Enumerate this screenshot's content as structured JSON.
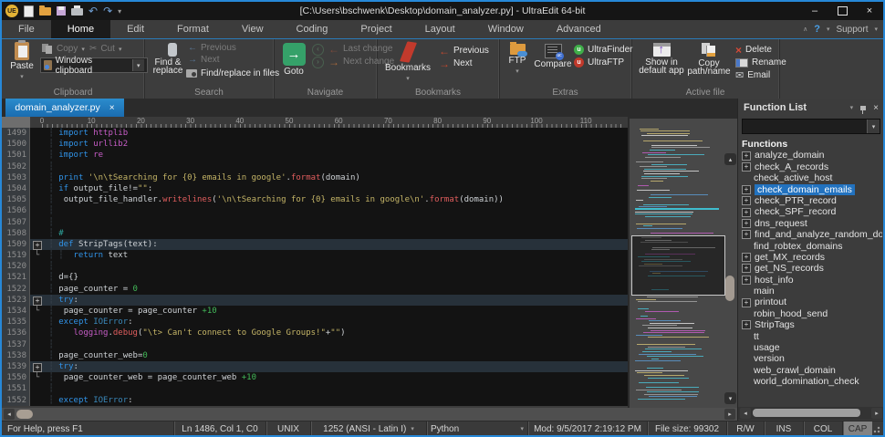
{
  "window": {
    "logo": "UE",
    "title": "[C:\\Users\\bschwenk\\Desktop\\domain_analyzer.py] - UltraEdit 64-bit",
    "minimize": "–",
    "close": "×"
  },
  "icons": {
    "dropdown": "▾",
    "collapse": "∧",
    "help": "?",
    "undo": "↶",
    "redo": "↷",
    "scissors": "✂",
    "envelope": "✉",
    "left": "◂",
    "right": "▸",
    "up": "▴",
    "down": "▾",
    "arrow_left": "←",
    "arrow_right": "→",
    "goto_arrow": "→",
    "delete_x": "×",
    "expand": "+",
    "fold_end": "└",
    "close": "×",
    "circ_left": "‹",
    "circ_right": "›"
  },
  "menu": {
    "items": [
      "File",
      "Home",
      "Edit",
      "Format",
      "View",
      "Coding",
      "Project",
      "Layout",
      "Window",
      "Advanced"
    ],
    "active": "Home",
    "support": "Support"
  },
  "ribbon": {
    "clipboard": {
      "label": "Clipboard",
      "paste": "Paste",
      "copy": "Copy",
      "cut": "Cut",
      "windows_clipboard": "Windows clipboard"
    },
    "search": {
      "label": "Search",
      "find_replace_1": "Find &",
      "find_replace_2": "replace",
      "previous": "Previous",
      "next": "Next",
      "find_in_files": "Find/replace in files"
    },
    "navigate": {
      "label": "Navigate",
      "goto": "Goto",
      "last_change": "Last change",
      "next_change": "Next change"
    },
    "bookmarks": {
      "label": "Bookmarks",
      "bookmarks": "Bookmarks",
      "previous": "Previous",
      "next": "Next"
    },
    "extras": {
      "label": "Extras",
      "ftp": "FTP",
      "compare": "Compare",
      "ultrafinder": "UltraFinder",
      "ultraftp": "UltraFTP",
      "uf_badge": "u",
      "uftp_badge": "u"
    },
    "active_file": {
      "label": "Active file",
      "show_in_1": "Show in",
      "show_in_2": "default app",
      "copy_path_1": "Copy",
      "copy_path_2": "path/name",
      "delete": "Delete",
      "rename": "Rename",
      "email": "Email"
    }
  },
  "editor": {
    "tab": {
      "name": "domain_analyzer.py",
      "close": "×"
    },
    "ruler_marks": [
      "0",
      "10",
      "20",
      "30",
      "40",
      "50",
      "60",
      "70",
      "80",
      "90",
      "100",
      "110"
    ],
    "lines": [
      {
        "n": "1499",
        "t": [
          [
            "gd",
            " ┆ "
          ],
          [
            "kw",
            "import "
          ],
          [
            "mod",
            "httplib"
          ]
        ]
      },
      {
        "n": "1500",
        "t": [
          [
            "gd",
            " ┆ "
          ],
          [
            "kw",
            "import "
          ],
          [
            "mod",
            "urllib2"
          ]
        ]
      },
      {
        "n": "1501",
        "t": [
          [
            "gd",
            " ┆ "
          ],
          [
            "kw",
            "import "
          ],
          [
            "mod",
            "re"
          ]
        ]
      },
      {
        "n": "1502",
        "t": [
          [
            "gd",
            " ┆"
          ]
        ]
      },
      {
        "n": "1503",
        "t": [
          [
            "gd",
            " ┆ "
          ],
          [
            "kw",
            "print "
          ],
          [
            "str",
            "'\\n\\tSearching for {0} emails in google'"
          ],
          [
            "pl",
            "."
          ],
          [
            "fn",
            "format"
          ],
          [
            "pl",
            "(domain)"
          ]
        ]
      },
      {
        "n": "1504",
        "t": [
          [
            "gd",
            " ┆ "
          ],
          [
            "kw",
            "if "
          ],
          [
            "pl",
            "output_file!="
          ],
          [
            "str",
            "\"\""
          ],
          [
            "pl",
            ":"
          ]
        ]
      },
      {
        "n": "1505",
        "t": [
          [
            "gd",
            " ┆  "
          ],
          [
            "pl",
            "output_file_handler."
          ],
          [
            "fn",
            "writelines"
          ],
          [
            "pl",
            "("
          ],
          [
            "str",
            "'\\n\\tSearching for {0} emails in google\\n'"
          ],
          [
            "pl",
            "."
          ],
          [
            "fn",
            "format"
          ],
          [
            "pl",
            "(domain))"
          ]
        ]
      },
      {
        "n": "1506",
        "t": [
          [
            "gd",
            " ┆"
          ]
        ]
      },
      {
        "n": "1507",
        "t": [
          [
            "gd",
            " ┆"
          ]
        ]
      },
      {
        "n": "1508",
        "t": [
          [
            "gd",
            " ┆ "
          ],
          [
            "cmt",
            "#"
          ]
        ]
      },
      {
        "n": "1509",
        "fold": "+",
        "hl": true,
        "t": [
          [
            "gd",
            " ┆ "
          ],
          [
            "kw",
            "def "
          ],
          [
            "pl",
            "StripTags(text):"
          ]
        ]
      },
      {
        "n": "1519",
        "fold": "L",
        "t": [
          [
            "gd",
            " ┆ ┆  "
          ],
          [
            "kw",
            "return "
          ],
          [
            "pl",
            "text"
          ]
        ]
      },
      {
        "n": "1520",
        "t": [
          [
            "gd",
            " ┆"
          ]
        ]
      },
      {
        "n": "1521",
        "t": [
          [
            "gd",
            " ┆ "
          ],
          [
            "pl",
            "d={}"
          ]
        ]
      },
      {
        "n": "1522",
        "t": [
          [
            "gd",
            " ┆ "
          ],
          [
            "pl",
            "page_counter = "
          ],
          [
            "num",
            "0"
          ]
        ]
      },
      {
        "n": "1523",
        "fold": "+",
        "hl": true,
        "t": [
          [
            "gd",
            " ┆ "
          ],
          [
            "kw",
            "try"
          ],
          [
            "pl",
            ":"
          ]
        ]
      },
      {
        "n": "1534",
        "fold": "L",
        "t": [
          [
            "gd",
            " ┆  "
          ],
          [
            "pl",
            "page_counter = page_counter "
          ],
          [
            "num",
            "+10"
          ]
        ]
      },
      {
        "n": "1535",
        "t": [
          [
            "gd",
            " ┆ "
          ],
          [
            "kw",
            "except "
          ],
          [
            "exc",
            "IOError"
          ],
          [
            "pl",
            ":"
          ]
        ]
      },
      {
        "n": "1536",
        "t": [
          [
            "gd",
            " ┆    "
          ],
          [
            "mod",
            "logging"
          ],
          [
            "pl",
            "."
          ],
          [
            "fn",
            "debug"
          ],
          [
            "pl",
            "("
          ],
          [
            "str",
            "\"\\t> Can't connect to Google Groups!\""
          ],
          [
            "pl",
            "+"
          ],
          [
            "str",
            "\"\""
          ],
          [
            "pl",
            ")"
          ]
        ]
      },
      {
        "n": "1537",
        "t": [
          [
            "gd",
            " ┆"
          ]
        ]
      },
      {
        "n": "1538",
        "t": [
          [
            "gd",
            " ┆ "
          ],
          [
            "pl",
            "page_counter_web="
          ],
          [
            "num",
            "0"
          ]
        ]
      },
      {
        "n": "1539",
        "fold": "+",
        "hl": true,
        "t": [
          [
            "gd",
            " ┆ "
          ],
          [
            "kw",
            "try"
          ],
          [
            "pl",
            ":"
          ]
        ]
      },
      {
        "n": "1550",
        "fold": "L",
        "t": [
          [
            "gd",
            " ┆  "
          ],
          [
            "pl",
            "page_counter_web = page_counter_web "
          ],
          [
            "num",
            "+10"
          ]
        ]
      },
      {
        "n": "1551",
        "t": [
          [
            "gd",
            " ┆"
          ]
        ]
      },
      {
        "n": "1552",
        "t": [
          [
            "gd",
            " ┆ "
          ],
          [
            "kw",
            "except "
          ],
          [
            "exc",
            "IOError"
          ],
          [
            "pl",
            ":"
          ]
        ]
      }
    ]
  },
  "function_list": {
    "title": "Function List",
    "root": "Functions",
    "items": [
      {
        "label": "analyze_domain",
        "expand": true
      },
      {
        "label": "check_A_records",
        "expand": true
      },
      {
        "label": "check_active_host",
        "expand": false
      },
      {
        "label": "check_domain_emails",
        "expand": true,
        "selected": true
      },
      {
        "label": "check_PTR_record",
        "expand": true
      },
      {
        "label": "check_SPF_record",
        "expand": true
      },
      {
        "label": "dns_request",
        "expand": true
      },
      {
        "label": "find_and_analyze_random_domain",
        "expand": true
      },
      {
        "label": "find_robtex_domains",
        "expand": false
      },
      {
        "label": "get_MX_records",
        "expand": true
      },
      {
        "label": "get_NS_records",
        "expand": true
      },
      {
        "label": "host_info",
        "expand": true
      },
      {
        "label": "main",
        "expand": false
      },
      {
        "label": "printout",
        "expand": true
      },
      {
        "label": "robin_hood_send",
        "expand": false
      },
      {
        "label": "StripTags",
        "expand": true
      },
      {
        "label": "tt",
        "expand": false
      },
      {
        "label": "usage",
        "expand": false
      },
      {
        "label": "version",
        "expand": false
      },
      {
        "label": "web_crawl_domain",
        "expand": false
      },
      {
        "label": "world_domination_check",
        "expand": false
      }
    ]
  },
  "status": {
    "help": "For Help, press F1",
    "position": "Ln 1486, Col 1, C0",
    "line_ending": "UNIX",
    "encoding": "1252  (ANSI - Latin I)",
    "language": "Python",
    "modified": "Mod: 9/5/2017 2:19:12 PM",
    "file_size": "File size: 99302",
    "rw": "R/W",
    "ins": "INS",
    "col": "COL",
    "cap": "CAP"
  },
  "colors": {
    "accent_blue": "#2688d8",
    "tab_active": "#1f7cc2",
    "selection_blue": "#2272bf",
    "keyword": "#3093e8",
    "string": "#c5b567",
    "number": "#42b858",
    "method": "#e05d5d",
    "module": "#c75dc7"
  }
}
